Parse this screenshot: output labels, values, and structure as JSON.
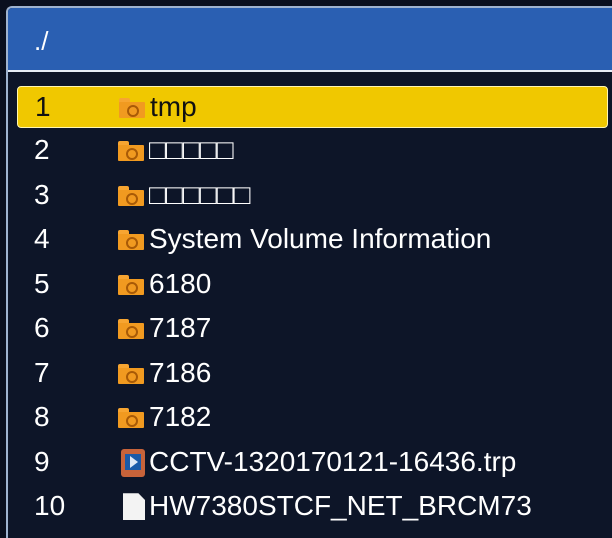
{
  "window": {
    "path": "./"
  },
  "files": [
    {
      "index": "1",
      "name": "tmp",
      "icon": "folder-icon",
      "selected": true
    },
    {
      "index": "2",
      "name": "□□□□□",
      "icon": "folder-icon"
    },
    {
      "index": "3",
      "name": "□□□□□□",
      "icon": "folder-icon"
    },
    {
      "index": "4",
      "name": "System Volume Information",
      "icon": "folder-icon"
    },
    {
      "index": "5",
      "name": "6180",
      "icon": "folder-icon"
    },
    {
      "index": "6",
      "name": "7187",
      "icon": "folder-icon"
    },
    {
      "index": "7",
      "name": "7186",
      "icon": "folder-icon"
    },
    {
      "index": "8",
      "name": "7182",
      "icon": "folder-icon"
    },
    {
      "index": "9",
      "name": "CCTV-1320170121-16436.trp",
      "icon": "video-file-icon"
    },
    {
      "index": "10",
      "name": "HW7380STCF_NET_BRCM73",
      "icon": "document-icon"
    }
  ],
  "colors": {
    "title_bar": "#2a5fb2",
    "background": "#0d1528",
    "selection": "#f0c800"
  }
}
